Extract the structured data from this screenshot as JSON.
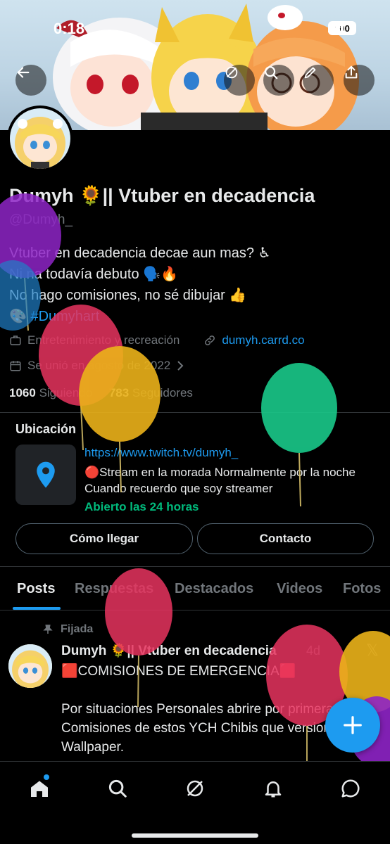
{
  "status_bar": {
    "time": "0:18",
    "battery": "100"
  },
  "profile": {
    "display_name": "Dumyh 🌻|| Vtuber en decadencia",
    "handle": "@Dumyh_",
    "bio_lines": [
      "Vtuber en decadencia decae aun mas? ♿",
      "Ni na todavía debuto 🗣️🔥",
      "No hago comisiones, no sé dibujar 👍"
    ],
    "bio_tag": "🎨 #Dumyhart",
    "category": "Entretenimiento y recreación",
    "website": "dumyh.carrd.co",
    "joined": "Se unió en agosto de 2022",
    "following_count": "1060",
    "following_label": "Siguiendo",
    "followers_count": "783",
    "followers_label": "Seguidores"
  },
  "location": {
    "title": "Ubicación",
    "url": "https://www.twitch.tv/dumyh_",
    "description": "🔴Stream en la morada Normalmente por la noche  Cuando recuerdo que soy streamer",
    "hours": "Abierto las 24 horas",
    "directions_label": "Cómo llegar",
    "contact_label": "Contacto"
  },
  "tabs": [
    "Posts",
    "Respuestas",
    "Destacados",
    "Videos",
    "Fotos"
  ],
  "post": {
    "pinned_label": "Fijada",
    "author": "Dumyh 🌻|| Vtuber en decadencia",
    "time": "4d",
    "body": "🟥COMISIONES DE EMERGENCIA🟥\n\nPor situaciones Personales abrire por primera vez Comisiones de estos YCH Chibis que version  Wallpaper."
  },
  "colors": {
    "accent": "#1d9bf0",
    "open_green": "#00ba7c",
    "background": "#000000"
  },
  "icons": [
    "back-arrow-icon",
    "grok-icon",
    "search-icon",
    "edit-icon",
    "share-icon",
    "home-icon",
    "explore-icon",
    "bell-icon",
    "messages-icon",
    "plus-icon",
    "pin-icon",
    "link-icon",
    "calendar-icon",
    "briefcase-icon",
    "map-pin-icon"
  ]
}
